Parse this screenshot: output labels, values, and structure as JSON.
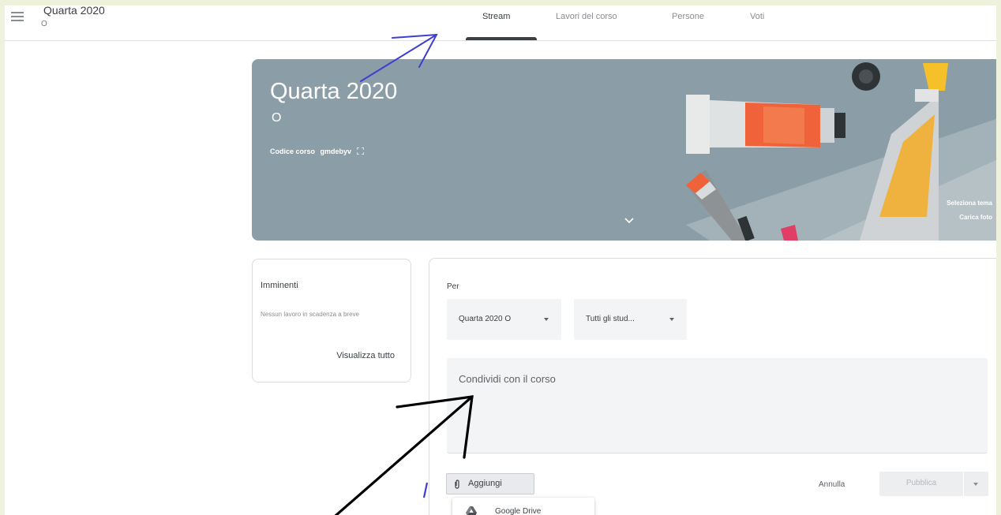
{
  "header": {
    "class_title": "Quarta 2020",
    "class_section": "O",
    "tabs": [
      {
        "label": "Stream",
        "active": true
      },
      {
        "label": "Lavori del corso",
        "active": false
      },
      {
        "label": "Persone",
        "active": false
      },
      {
        "label": "Voti",
        "active": false
      }
    ]
  },
  "banner": {
    "title": "Quarta 2020",
    "section": "O",
    "course_code_label": "Codice corso",
    "course_code_value": "gmdebyv",
    "select_theme": "Seleziona tema",
    "upload_photo": "Carica foto",
    "background_color": "#8b9ea7"
  },
  "upcoming": {
    "title": "Imminenti",
    "message": "Nessun lavoro in scadenza a breve",
    "view_all": "Visualizza tutto"
  },
  "composer": {
    "for_label": "Per",
    "class_select": "Quarta 2020 O",
    "students_select": "Tutti gli stud...",
    "placeholder": "Condividi con il corso",
    "add_button": "Aggiungi",
    "cancel_button": "Annulla",
    "publish_button": "Pubblica",
    "add_menu": {
      "items": [
        {
          "label": "Google Drive",
          "icon": "google-drive-icon"
        }
      ]
    }
  },
  "annotation_colors": {
    "blue_arrow": "#3d3fd1",
    "black_arrow": "#000000"
  }
}
